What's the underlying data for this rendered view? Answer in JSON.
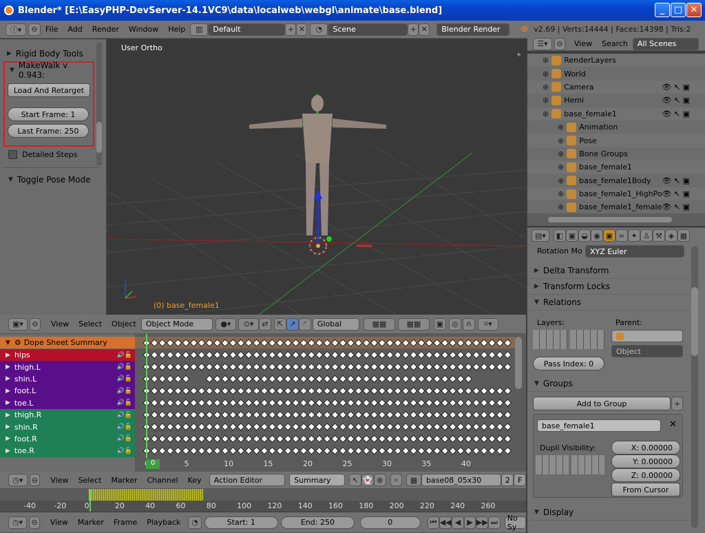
{
  "window": {
    "title": "Blender* [E:\\EasyPHP-DevServer-14.1VC9\\data\\localweb\\webgl\\animate\\base.blend]"
  },
  "top_menu": {
    "items": [
      "File",
      "Add",
      "Render",
      "Window",
      "Help"
    ],
    "layout": "Default",
    "scene": "Scene",
    "engine": "Blender Render",
    "stats": "v2.69 | Verts:14444 | Faces:14398 | Tris:2"
  },
  "toolshelf": {
    "rigid_body": "Rigid Body Tools",
    "makewalk": "MakeWalk v 0.943:",
    "load_retarget": "Load And Retarget",
    "start_frame": "Start Frame: 1",
    "last_frame": "Last Frame: 250",
    "detailed_steps": "Detailed Steps",
    "toggle_pose": "Toggle Pose Mode"
  },
  "viewport": {
    "view_label": "User Ortho",
    "object_label": "(0) base_female1"
  },
  "view3d_header": {
    "view": "View",
    "select": "Select",
    "object": "Object",
    "mode": "Object Mode",
    "orientation": "Global"
  },
  "outliner": {
    "view": "View",
    "search": "Search",
    "scenes": "All Scenes",
    "rows": [
      {
        "label": "RenderLayers",
        "indent": 1,
        "vis": false
      },
      {
        "label": "World",
        "indent": 1,
        "vis": false
      },
      {
        "label": "Camera",
        "indent": 1,
        "vis": true
      },
      {
        "label": "Hemi",
        "indent": 1,
        "vis": true
      },
      {
        "label": "base_female1",
        "indent": 1,
        "vis": true
      },
      {
        "label": "Animation",
        "indent": 2,
        "vis": false
      },
      {
        "label": "Pose",
        "indent": 2,
        "vis": false
      },
      {
        "label": "Bone Groups",
        "indent": 2,
        "vis": false
      },
      {
        "label": "base_female1",
        "indent": 2,
        "vis": false
      },
      {
        "label": "base_female1Body",
        "indent": 2,
        "vis": true
      },
      {
        "label": "base_female1_HighPo",
        "indent": 2,
        "vis": true
      },
      {
        "label": "base_female1_female",
        "indent": 2,
        "vis": true
      }
    ]
  },
  "properties": {
    "rotation_mode_label": "Rotation Mo",
    "rotation_mode": "XYZ Euler",
    "delta": "Delta Transform",
    "locks": "Transform Locks",
    "relations": "Relations",
    "layers": "Layers:",
    "parent": "Parent:",
    "parent_type": "Object",
    "pass_index": "Pass Index: 0",
    "groups": "Groups",
    "add_group": "Add to Group",
    "group_name": "base_female1",
    "dupli": "Dupli Visibility:",
    "x": "X: 0.00000",
    "y": "Y: 0.00000",
    "z": "Z: 0.00000",
    "from_cursor": "From Cursor",
    "display": "Display"
  },
  "dopesheet": {
    "summary": "Dope Sheet Summary",
    "channels": [
      {
        "name": "hips",
        "color": "#b5102a"
      },
      {
        "name": "thigh.L",
        "color": "#5a0f8a"
      },
      {
        "name": "shin.L",
        "color": "#5a0f8a"
      },
      {
        "name": "foot.L",
        "color": "#5a0f8a"
      },
      {
        "name": "toe.L",
        "color": "#5a0f8a"
      },
      {
        "name": "thigh.R",
        "color": "#1f7f55"
      },
      {
        "name": "shin.R",
        "color": "#1f7f55"
      },
      {
        "name": "foot.R",
        "color": "#1f7f55"
      },
      {
        "name": "toe.R",
        "color": "#1f7f55"
      }
    ],
    "frame_ticks": [
      "0",
      "5",
      "10",
      "15",
      "20",
      "25",
      "30",
      "35",
      "40"
    ],
    "current_frame": "0"
  },
  "dope_header": {
    "view": "View",
    "select": "Select",
    "marker": "Marker",
    "channel": "Channel",
    "key": "Key",
    "mode": "Action Editor",
    "summary": "Summary",
    "action": "base08_05x30",
    "users": "2",
    "fake": "F"
  },
  "timeline": {
    "ticks": [
      "-40",
      "-20",
      "0",
      "20",
      "40",
      "60",
      "80",
      "100",
      "120",
      "140",
      "160",
      "180",
      "200",
      "220",
      "240",
      "260"
    ],
    "view": "View",
    "marker": "Marker",
    "frame": "Frame",
    "playback": "Playback",
    "start": "Start: 1",
    "end": "End: 250",
    "current": "0",
    "sync": "No Sy"
  }
}
